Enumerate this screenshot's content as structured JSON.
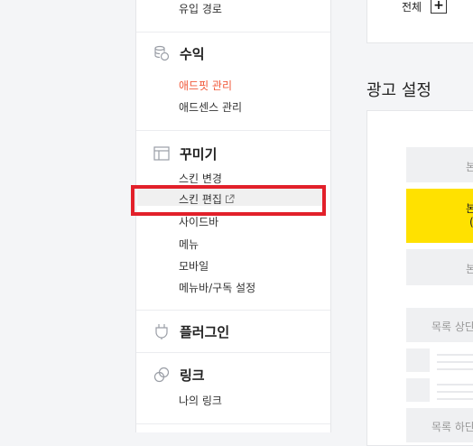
{
  "sidebar": {
    "top_item": "유입 경로",
    "sections": [
      {
        "title": "수익",
        "icon": "coins-icon",
        "items": [
          {
            "label": "애드핏 관리",
            "active": true
          },
          {
            "label": "애드센스 관리"
          }
        ]
      },
      {
        "title": "꾸미기",
        "icon": "layout-icon",
        "items": [
          {
            "label": "스킨 변경"
          },
          {
            "label": "스킨 편집",
            "external": true,
            "highlighted": true
          },
          {
            "label": "사이드바"
          },
          {
            "label": "메뉴"
          },
          {
            "label": "모바일"
          },
          {
            "label": "메뉴바/구독 설정"
          }
        ]
      },
      {
        "title": "플러그인",
        "icon": "plug-icon"
      },
      {
        "title": "링크",
        "icon": "link-icon",
        "items": [
          {
            "label": "나의 링크"
          }
        ]
      }
    ]
  },
  "main": {
    "top_panel": {
      "all_label": "전체",
      "add_symbol": "+"
    },
    "ad_settings_title": "광고 설정",
    "slots": {
      "slot1": "본",
      "slot2_line1": "본",
      "slot2_line2": "(",
      "slot3": "본",
      "list_top": "목록 상단",
      "list_bottom": "목록 하단"
    }
  },
  "colors": {
    "active_link": "#f15a3b",
    "highlight_box": "#e2202a",
    "accent_yellow": "#ffe100"
  }
}
